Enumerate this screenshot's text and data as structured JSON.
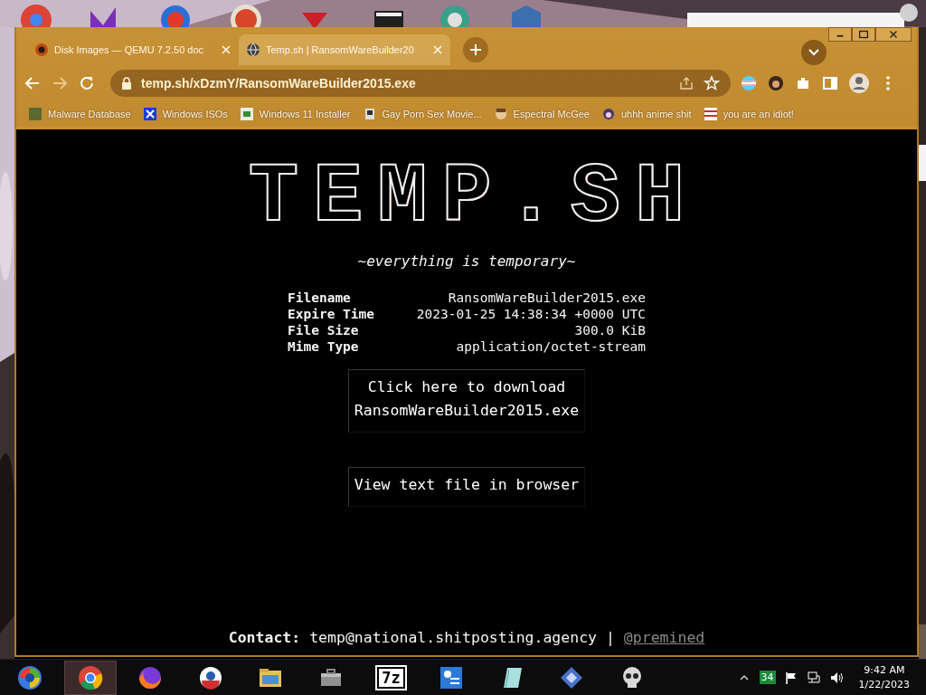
{
  "browser": {
    "tabs": [
      {
        "title": "Disk Images — QEMU 7.2.50 doc",
        "selected": false
      },
      {
        "title": "Temp.sh | RansomWareBuilder20",
        "selected": true
      }
    ],
    "address": "temp.sh/xDzmY/RansomWareBuilder2015.exe",
    "bookmarks": [
      "Malware Database",
      "Windows ISOs",
      "Windows 11 Installer",
      "Gay Porn Sex Movie...",
      "Espectral McGee",
      "uhhh anime shit",
      "you are an idiot!"
    ]
  },
  "page": {
    "logo": "TEMP.SH",
    "tagline": "~everything is temporary~",
    "file_info": [
      {
        "label": "Filename",
        "value": "RansomWareBuilder2015.exe"
      },
      {
        "label": "Expire Time",
        "value": "2023-01-25 14:38:34 +0000 UTC"
      },
      {
        "label": "File Size",
        "value": "300.0 KiB"
      },
      {
        "label": "Mime Type",
        "value": "application/octet-stream"
      }
    ],
    "download_button": [
      "Click here to download",
      "RansomWareBuilder2015.exe"
    ],
    "view_button": "View text file in browser",
    "contact": {
      "label": "Contact:",
      "email": "temp@national.shitposting.agency",
      "separator": "|",
      "handle": "@premined"
    }
  },
  "taskbar": {
    "apps": [
      {
        "selected": false
      },
      {
        "selected": true
      },
      {
        "selected": false
      },
      {
        "selected": false
      },
      {
        "selected": false
      },
      {
        "selected": false
      },
      {
        "label": "7z",
        "selected": false
      },
      {
        "selected": false
      },
      {
        "selected": false
      },
      {
        "selected": false
      },
      {
        "selected": false
      }
    ],
    "tray_badge": "34",
    "time": "9:42 AM",
    "date": "1/22/2023"
  }
}
